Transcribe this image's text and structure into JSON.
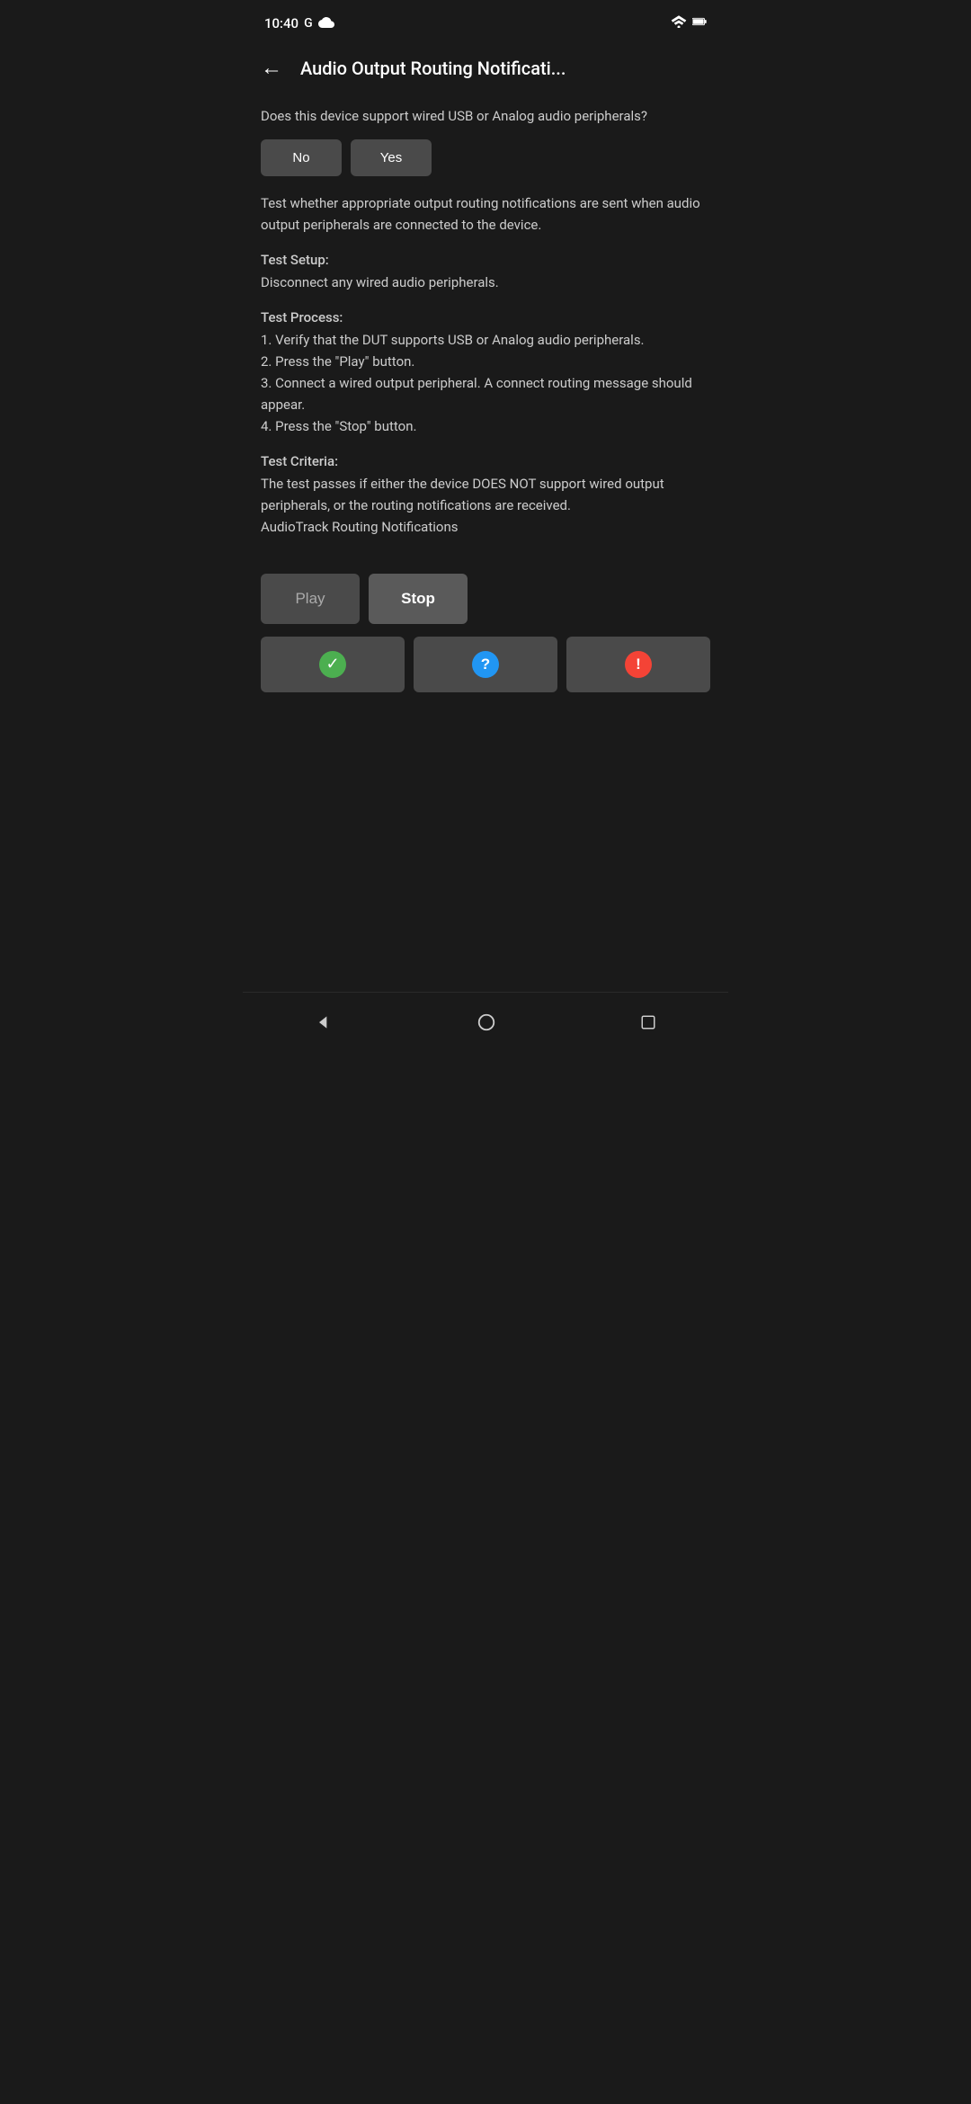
{
  "statusBar": {
    "time": "10:40",
    "googleLogo": "G",
    "cloudIcon": "cloud"
  },
  "toolbar": {
    "backLabel": "←",
    "title": "Audio Output Routing Notificati..."
  },
  "content": {
    "question": "Does this device support wired USB or Analog audio peripherals?",
    "noLabel": "No",
    "yesLabel": "Yes",
    "description": "Test whether appropriate output routing notifications are sent when audio output peripherals are connected to the device.",
    "testSetupTitle": "Test Setup:",
    "testSetupContent": "Disconnect any wired audio peripherals.",
    "testProcessTitle": "Test Process:",
    "testProcessContent": "1. Verify that the DUT supports USB or Analog audio peripherals.\n2. Press the \"Play\" button.\n3. Connect a wired output peripheral. A connect routing message should appear.\n4. Press the \"Stop\" button.",
    "testCriteriaTitle": "Test Criteria:",
    "testCriteriaContent": "The test passes if either the device DOES NOT support wired output peripherals, or the routing notifications are received.\nAudioTrack Routing Notifications"
  },
  "actions": {
    "playLabel": "Play",
    "stopLabel": "Stop"
  },
  "results": {
    "passIcon": "checkmark",
    "infoIcon": "question",
    "failIcon": "exclamation"
  },
  "navBar": {
    "backIcon": "back-triangle",
    "homeIcon": "home-circle",
    "recentIcon": "recent-square"
  }
}
